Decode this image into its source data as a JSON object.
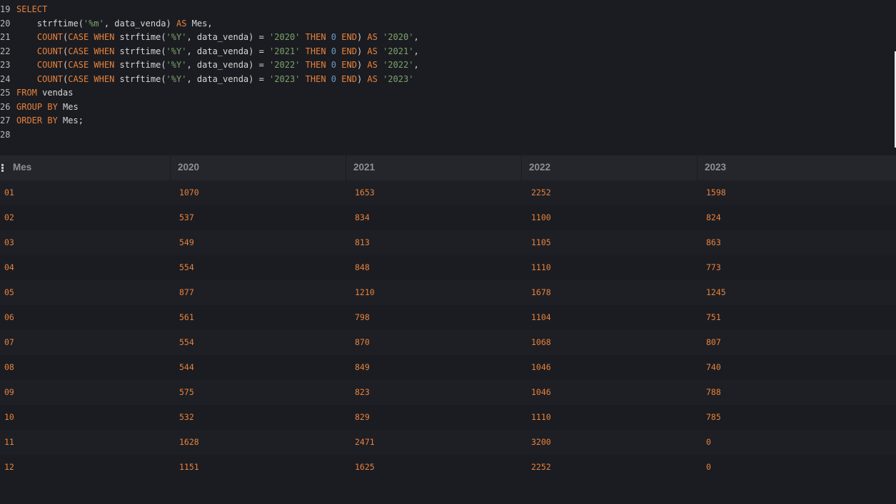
{
  "editor": {
    "lines": [
      {
        "number": "19",
        "tokens": [
          {
            "t": "kw",
            "v": "SELECT"
          }
        ]
      },
      {
        "number": "20",
        "tokens": [
          {
            "t": "plain",
            "v": "    strftime("
          },
          {
            "t": "str",
            "v": "'%m'"
          },
          {
            "t": "plain",
            "v": ", data_venda) "
          },
          {
            "t": "kw",
            "v": "AS"
          },
          {
            "t": "plain",
            "v": " Mes,"
          }
        ]
      },
      {
        "number": "21",
        "tokens": [
          {
            "t": "plain",
            "v": "    "
          },
          {
            "t": "kw",
            "v": "COUNT"
          },
          {
            "t": "plain",
            "v": "("
          },
          {
            "t": "kw",
            "v": "CASE WHEN"
          },
          {
            "t": "plain",
            "v": " strftime("
          },
          {
            "t": "str",
            "v": "'%Y'"
          },
          {
            "t": "plain",
            "v": ", data_venda) = "
          },
          {
            "t": "str",
            "v": "'2020'"
          },
          {
            "t": "plain",
            "v": " "
          },
          {
            "t": "kw",
            "v": "THEN"
          },
          {
            "t": "plain",
            "v": " "
          },
          {
            "t": "num",
            "v": "0"
          },
          {
            "t": "plain",
            "v": " "
          },
          {
            "t": "kw",
            "v": "END"
          },
          {
            "t": "plain",
            "v": ") "
          },
          {
            "t": "kw",
            "v": "AS"
          },
          {
            "t": "plain",
            "v": " "
          },
          {
            "t": "str",
            "v": "'2020'"
          },
          {
            "t": "plain",
            "v": ","
          }
        ]
      },
      {
        "number": "22",
        "tokens": [
          {
            "t": "plain",
            "v": "    "
          },
          {
            "t": "kw",
            "v": "COUNT"
          },
          {
            "t": "plain",
            "v": "("
          },
          {
            "t": "kw",
            "v": "CASE WHEN"
          },
          {
            "t": "plain",
            "v": " strftime("
          },
          {
            "t": "str",
            "v": "'%Y'"
          },
          {
            "t": "plain",
            "v": ", data_venda) = "
          },
          {
            "t": "str",
            "v": "'2021'"
          },
          {
            "t": "plain",
            "v": " "
          },
          {
            "t": "kw",
            "v": "THEN"
          },
          {
            "t": "plain",
            "v": " "
          },
          {
            "t": "num",
            "v": "0"
          },
          {
            "t": "plain",
            "v": " "
          },
          {
            "t": "kw",
            "v": "END"
          },
          {
            "t": "plain",
            "v": ") "
          },
          {
            "t": "kw",
            "v": "AS"
          },
          {
            "t": "plain",
            "v": " "
          },
          {
            "t": "str",
            "v": "'2021'"
          },
          {
            "t": "plain",
            "v": ","
          }
        ]
      },
      {
        "number": "23",
        "tokens": [
          {
            "t": "plain",
            "v": "    "
          },
          {
            "t": "kw",
            "v": "COUNT"
          },
          {
            "t": "plain",
            "v": "("
          },
          {
            "t": "kw",
            "v": "CASE WHEN"
          },
          {
            "t": "plain",
            "v": " strftime("
          },
          {
            "t": "str",
            "v": "'%Y'"
          },
          {
            "t": "plain",
            "v": ", data_venda) = "
          },
          {
            "t": "str",
            "v": "'2022'"
          },
          {
            "t": "plain",
            "v": " "
          },
          {
            "t": "kw",
            "v": "THEN"
          },
          {
            "t": "plain",
            "v": " "
          },
          {
            "t": "num",
            "v": "0"
          },
          {
            "t": "plain",
            "v": " "
          },
          {
            "t": "kw",
            "v": "END"
          },
          {
            "t": "plain",
            "v": ") "
          },
          {
            "t": "kw",
            "v": "AS"
          },
          {
            "t": "plain",
            "v": " "
          },
          {
            "t": "str",
            "v": "'2022'"
          },
          {
            "t": "plain",
            "v": ","
          }
        ]
      },
      {
        "number": "24",
        "tokens": [
          {
            "t": "plain",
            "v": "    "
          },
          {
            "t": "kw",
            "v": "COUNT"
          },
          {
            "t": "plain",
            "v": "("
          },
          {
            "t": "kw",
            "v": "CASE WHEN"
          },
          {
            "t": "plain",
            "v": " strftime("
          },
          {
            "t": "str",
            "v": "'%Y'"
          },
          {
            "t": "plain",
            "v": ", data_venda) = "
          },
          {
            "t": "str",
            "v": "'2023'"
          },
          {
            "t": "plain",
            "v": " "
          },
          {
            "t": "kw",
            "v": "THEN"
          },
          {
            "t": "plain",
            "v": " "
          },
          {
            "t": "num",
            "v": "0"
          },
          {
            "t": "plain",
            "v": " "
          },
          {
            "t": "kw",
            "v": "END"
          },
          {
            "t": "plain",
            "v": ") "
          },
          {
            "t": "kw",
            "v": "AS"
          },
          {
            "t": "plain",
            "v": " "
          },
          {
            "t": "str",
            "v": "'2023'"
          }
        ]
      },
      {
        "number": "25",
        "tokens": [
          {
            "t": "kw",
            "v": "FROM"
          },
          {
            "t": "plain",
            "v": " vendas"
          }
        ]
      },
      {
        "number": "26",
        "tokens": [
          {
            "t": "kw",
            "v": "GROUP BY"
          },
          {
            "t": "plain",
            "v": " Mes"
          }
        ]
      },
      {
        "number": "27",
        "tokens": [
          {
            "t": "kw",
            "v": "ORDER BY"
          },
          {
            "t": "plain",
            "v": " Mes;"
          }
        ]
      },
      {
        "number": "28",
        "tokens": []
      }
    ]
  },
  "results": {
    "columns": [
      "Mes",
      "2020",
      "2021",
      "2022",
      "2023"
    ],
    "rows": [
      [
        "01",
        "1070",
        "1653",
        "2252",
        "1598"
      ],
      [
        "02",
        "537",
        "834",
        "1100",
        "824"
      ],
      [
        "03",
        "549",
        "813",
        "1105",
        "863"
      ],
      [
        "04",
        "554",
        "848",
        "1110",
        "773"
      ],
      [
        "05",
        "877",
        "1210",
        "1678",
        "1245"
      ],
      [
        "06",
        "561",
        "798",
        "1104",
        "751"
      ],
      [
        "07",
        "554",
        "870",
        "1068",
        "807"
      ],
      [
        "08",
        "544",
        "849",
        "1046",
        "740"
      ],
      [
        "09",
        "575",
        "823",
        "1046",
        "788"
      ],
      [
        "10",
        "532",
        "829",
        "1110",
        "785"
      ],
      [
        "11",
        "1628",
        "2471",
        "3200",
        "0"
      ],
      [
        "12",
        "1151",
        "1625",
        "2252",
        "0"
      ]
    ]
  },
  "colors": {
    "keyword": "#e8823c",
    "string": "#7ca36a",
    "number": "#6d9cbe",
    "background": "#1b1c21",
    "cell_value": "#e8823c"
  },
  "icons": {
    "column_grip": "drag-handle-icon"
  }
}
